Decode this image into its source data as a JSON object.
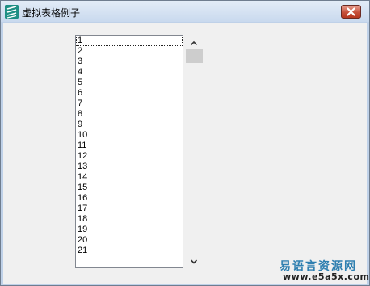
{
  "window": {
    "title": "虚拟表格例子",
    "icon": "app-logo-icon",
    "close_icon": "close-icon"
  },
  "list": {
    "items": [
      "1",
      "2",
      "3",
      "4",
      "5",
      "6",
      "7",
      "8",
      "9",
      "10",
      "11",
      "12",
      "13",
      "14",
      "15",
      "16",
      "17",
      "18",
      "19",
      "20",
      "21"
    ],
    "focused_index": 0
  },
  "scrollbar": {
    "up_icon": "chevron-up-icon",
    "down_icon": "chevron-down-icon"
  },
  "watermark": {
    "site_name": "易语言资源网",
    "url": "www.e5a5x.com"
  },
  "colors": {
    "titlebar": "#c9d9ee",
    "client_background": "#f0f0f0",
    "close_button": "#c6503b",
    "watermark_text": "#2f7fb0"
  }
}
